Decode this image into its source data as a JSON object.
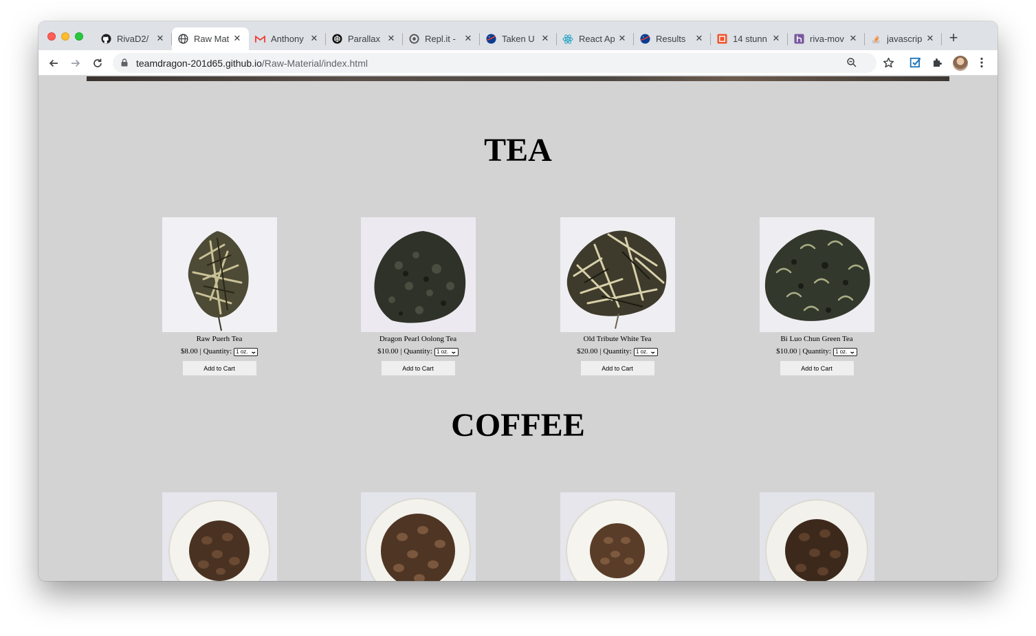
{
  "browser": {
    "tabs": [
      {
        "label": "RivaD2/",
        "favicon": "github-icon",
        "active": false
      },
      {
        "label": "Raw Mat",
        "favicon": "globe-icon",
        "active": true
      },
      {
        "label": "Anthony",
        "favicon": "gmail-icon",
        "active": false
      },
      {
        "label": "Parallax",
        "favicon": "codepen-icon",
        "active": false
      },
      {
        "label": "Repl.it -",
        "favicon": "replit-icon",
        "active": false
      },
      {
        "label": "Taken U",
        "favicon": "nasa-icon",
        "active": false
      },
      {
        "label": "React Ap",
        "favicon": "react-icon",
        "active": false
      },
      {
        "label": "Results",
        "favicon": "nasa-icon",
        "active": false
      },
      {
        "label": "14 stunn",
        "favicon": "codebeautify-icon",
        "active": false
      },
      {
        "label": "riva-mov",
        "favicon": "heroku-icon",
        "active": false
      },
      {
        "label": "javascrip",
        "favicon": "stackoverflow-icon",
        "active": false
      }
    ],
    "url_host": "teamdragon-201d65.github.io",
    "url_path": "/Raw-Material/index.html"
  },
  "sections": {
    "tea_title": "TEA",
    "coffee_title": "COFFEE"
  },
  "tea_products": [
    {
      "name": "Raw Puerh Tea",
      "price": "$8.00",
      "qty_label": "| Quantity:",
      "qty_value": "1 oz.",
      "button": "Add to Cart"
    },
    {
      "name": "Dragon Pearl Oolong Tea",
      "price": "$10.00",
      "qty_label": "| Quantity:",
      "qty_value": "1 oz.",
      "button": "Add to Cart"
    },
    {
      "name": "Old Tribute White Tea",
      "price": "$20.00",
      "qty_label": "| Quantity:",
      "qty_value": "1 oz.",
      "button": "Add to Cart"
    },
    {
      "name": "Bi Luo Chun Green Tea",
      "price": "$10.00",
      "qty_label": "| Quantity:",
      "qty_value": "1 oz.",
      "button": "Add to Cart"
    }
  ],
  "colors": {
    "page_background": "#d3d3d3",
    "tabstrip": "#dee1e6",
    "button_background": "#efefef"
  }
}
